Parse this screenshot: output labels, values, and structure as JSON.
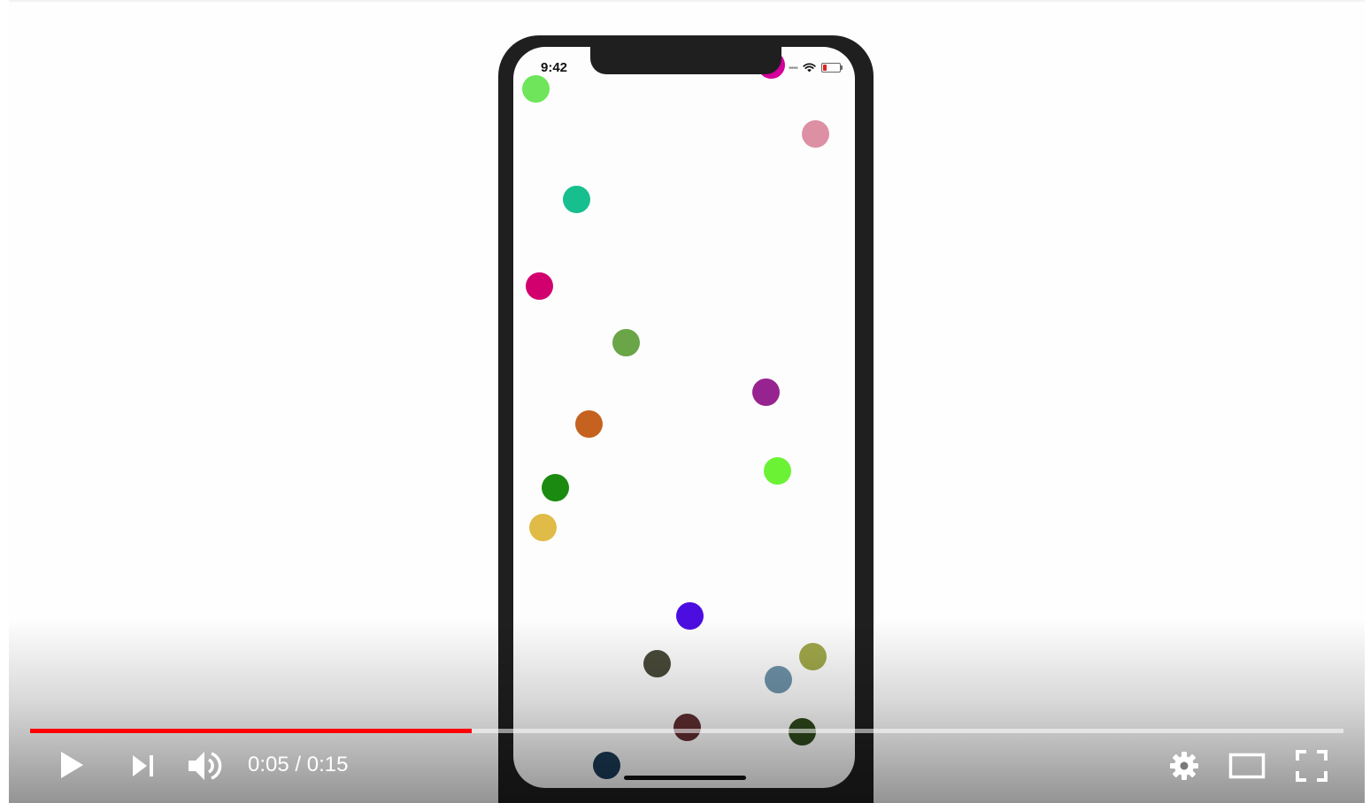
{
  "player": {
    "current_time": "0:05",
    "separator": "/",
    "duration": "0:15",
    "progress_fraction": 0.336
  },
  "phone": {
    "status_time": "9:42"
  },
  "balls": [
    {
      "color": "#6ee55a"
    },
    {
      "color": "#d4009a"
    },
    {
      "color": "#dd8fa4"
    },
    {
      "color": "#17bf8f"
    },
    {
      "color": "#d2006e"
    },
    {
      "color": "#6aa548"
    },
    {
      "color": "#972390"
    },
    {
      "color": "#c5621f"
    },
    {
      "color": "#6cf234"
    },
    {
      "color": "#1b8a10"
    },
    {
      "color": "#e0bb48"
    },
    {
      "color": "#4c0de0"
    },
    {
      "color": "#4a4a3a"
    },
    {
      "color": "#a0a84a"
    },
    {
      "color": "#6f94aa"
    },
    {
      "color": "#612e31"
    },
    {
      "color": "#2e4a1c"
    },
    {
      "color": "#1c3b57"
    }
  ]
}
